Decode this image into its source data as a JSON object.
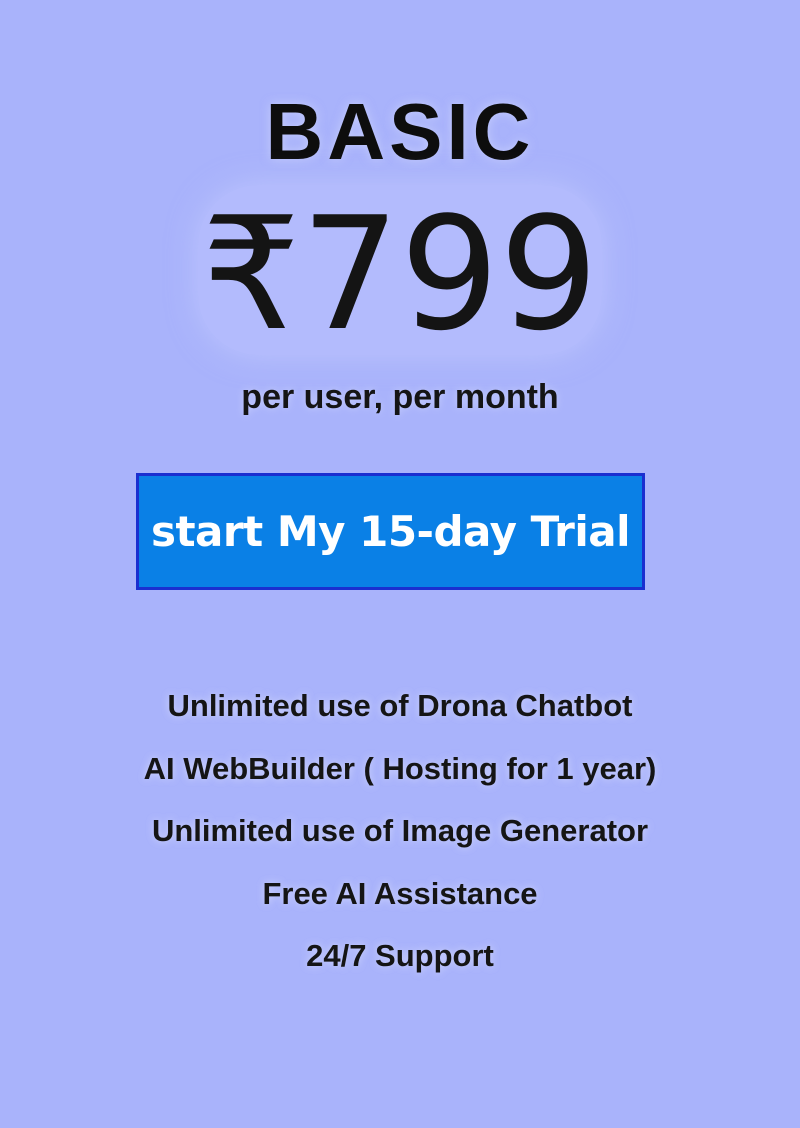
{
  "plan": {
    "name": "BASIC",
    "price": "₹799",
    "price_unit": "per user, per month",
    "cta_label": "start My 15-day Trial"
  },
  "features": [
    "Unlimited use of Drona Chatbot",
    "AI WebBuilder ( Hosting for 1 year)",
    "Unlimited use of Image Generator",
    "Free AI Assistance",
    "24/7 Support"
  ],
  "colors": {
    "background": "#a9b3fb",
    "cta_fill": "#0a80e6",
    "cta_border": "#1a2fd0",
    "cta_text": "#ffffff",
    "text": "#111111"
  }
}
